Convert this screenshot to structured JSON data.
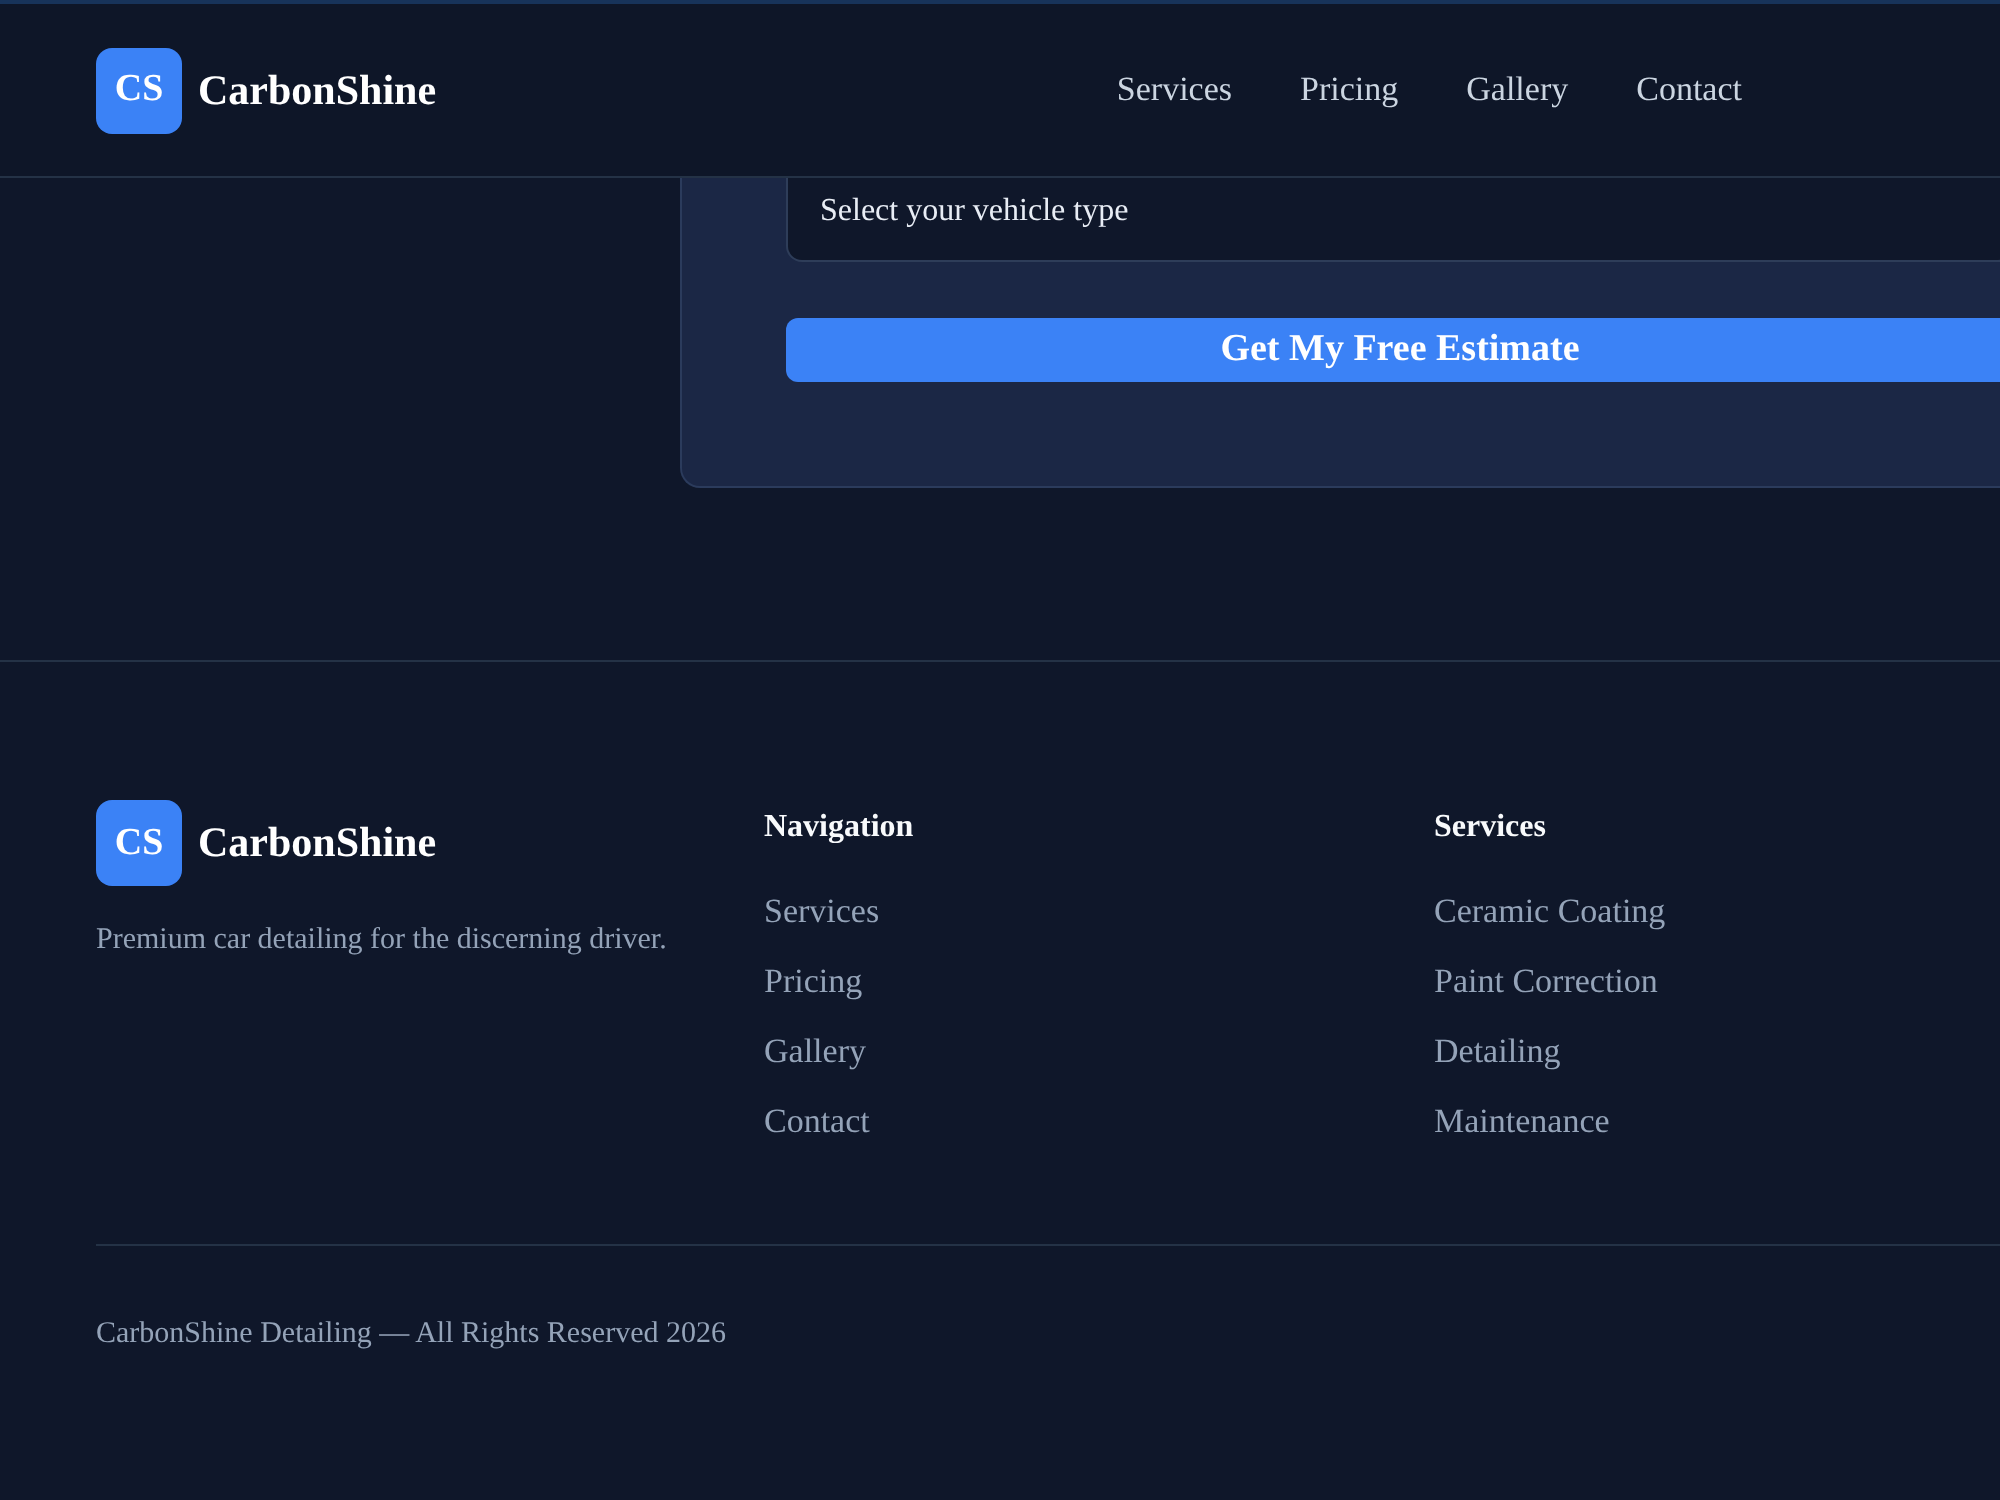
{
  "header": {
    "brand": {
      "badge": "CS",
      "name": "CarbonShine"
    },
    "nav": [
      {
        "label": "Services"
      },
      {
        "label": "Pricing"
      },
      {
        "label": "Gallery"
      },
      {
        "label": "Contact"
      }
    ]
  },
  "estimate_form": {
    "vehicle_select": {
      "value": "Select your vehicle type"
    },
    "submit_button": "Get My Free Estimate"
  },
  "footer": {
    "brand": {
      "badge": "CS",
      "name": "CarbonShine"
    },
    "tagline": "Premium car detailing for the discerning driver.",
    "columns": [
      {
        "heading": "Navigation",
        "links": [
          "Services",
          "Pricing",
          "Gallery",
          "Contact"
        ]
      },
      {
        "heading": "Services",
        "links": [
          "Ceramic Coating",
          "Paint Correction",
          "Detailing",
          "Maintenance"
        ]
      }
    ],
    "copyright": "CarbonShine Detailing — All Rights Reserved 2026"
  }
}
